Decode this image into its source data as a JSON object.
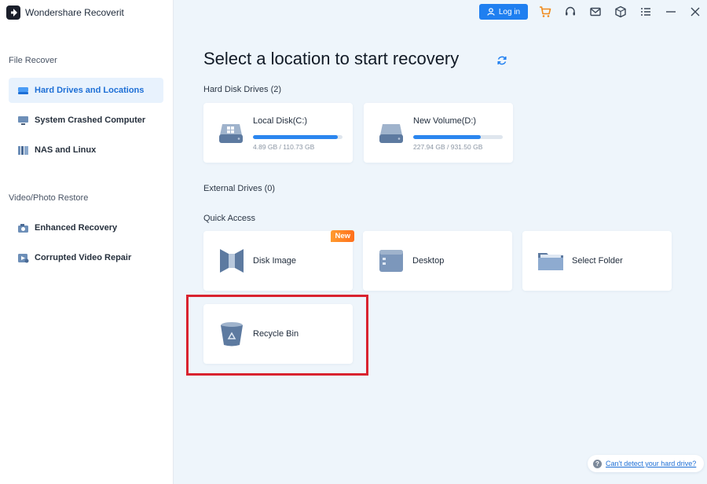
{
  "app": {
    "title": "Wondershare Recoverit",
    "colors": {
      "accent": "#1f7ff0",
      "highlight": "#d9232f",
      "badge": "#ff7a22"
    }
  },
  "header": {
    "login_label": "Log in",
    "icons": [
      "cart-icon",
      "headset-icon",
      "mail-icon",
      "box-icon",
      "menu-icon",
      "minimize-icon",
      "close-icon"
    ]
  },
  "sidebar": {
    "section1": "File Recover",
    "section2": "Video/Photo Restore",
    "items": [
      {
        "label": "Hard Drives and Locations",
        "icon": "hard-drive-icon",
        "active": true
      },
      {
        "label": "System Crashed Computer",
        "icon": "monitor-icon",
        "active": false
      },
      {
        "label": "NAS and Linux",
        "icon": "nas-icon",
        "active": false
      },
      {
        "label": "Enhanced Recovery",
        "icon": "camera-icon",
        "active": false
      },
      {
        "label": "Corrupted Video Repair",
        "icon": "video-repair-icon",
        "active": false
      }
    ]
  },
  "main": {
    "title": "Select a location to start recovery",
    "hard_disk_label": "Hard Disk Drives (2)",
    "drives": [
      {
        "name": "Local Disk(C:)",
        "size": "4.89 GB / 110.73 GB",
        "usage": 0.95
      },
      {
        "name": "New Volume(D:)",
        "size": "227.94 GB / 931.50 GB",
        "usage": 0.75
      }
    ],
    "external_label": "External Drives (0)",
    "quick_access_label": "Quick Access",
    "quick_access": [
      {
        "label": "Disk Image",
        "badge": "New"
      },
      {
        "label": "Desktop"
      },
      {
        "label": "Select Folder"
      },
      {
        "label": "Recycle Bin"
      }
    ]
  },
  "footer": {
    "help_link": "Can't detect your hard drive?"
  }
}
